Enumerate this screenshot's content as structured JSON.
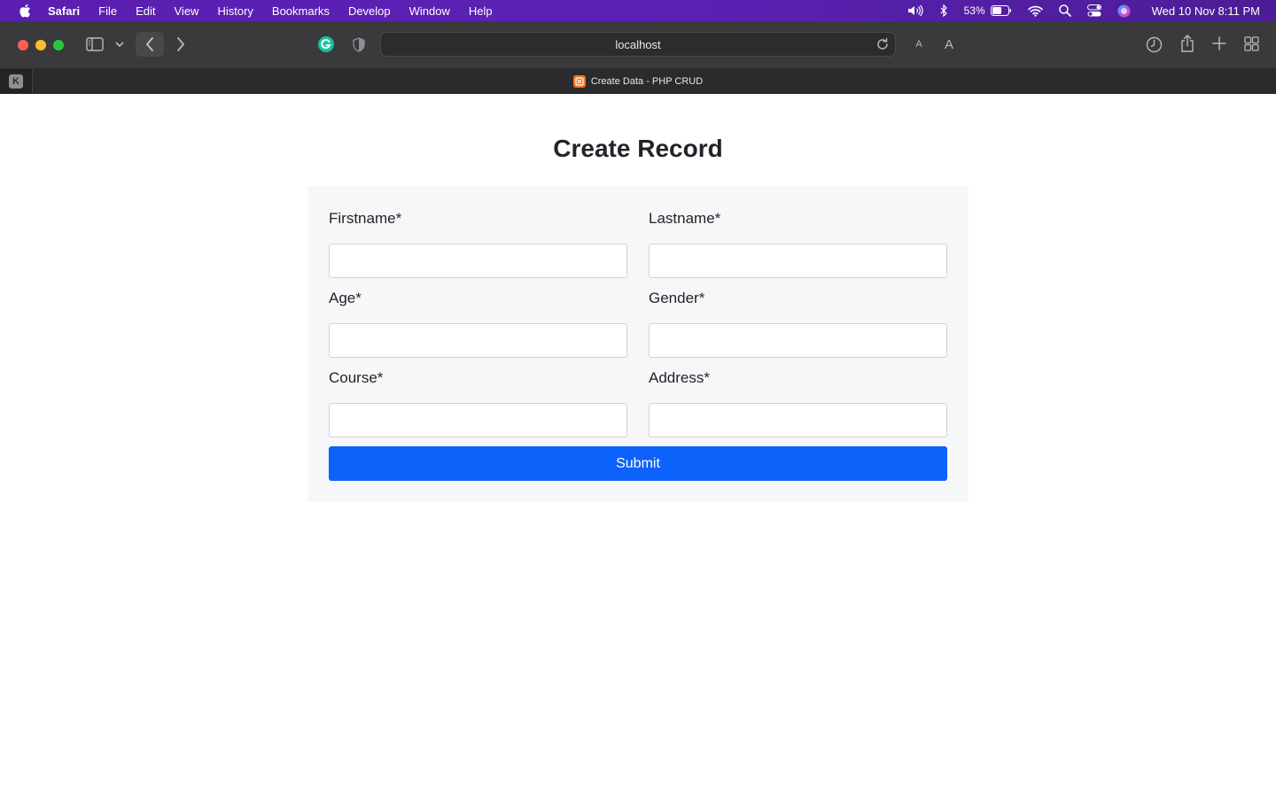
{
  "menubar": {
    "app_name": "Safari",
    "items": [
      "File",
      "Edit",
      "View",
      "History",
      "Bookmarks",
      "Develop",
      "Window",
      "Help"
    ],
    "battery_percent": "53%",
    "clock": "Wed 10 Nov  8:11 PM"
  },
  "toolbar": {
    "url": "localhost",
    "font_small": "A",
    "font_large": "A"
  },
  "tabbar": {
    "pinned_letter": "K",
    "tab_title": "Create Data - PHP CRUD"
  },
  "page": {
    "title": "Create Record",
    "fields": {
      "firstname": {
        "label": "Firstname*",
        "value": ""
      },
      "lastname": {
        "label": "Lastname*",
        "value": ""
      },
      "age": {
        "label": "Age*",
        "value": ""
      },
      "gender": {
        "label": "Gender*",
        "value": ""
      },
      "course": {
        "label": "Course*",
        "value": ""
      },
      "address": {
        "label": "Address*",
        "value": ""
      }
    },
    "submit_label": "Submit"
  },
  "colors": {
    "menubar": "#5b21b6",
    "toolbar": "#3a3a3c",
    "submit": "#0d62fb",
    "form_bg": "#f6f7f8"
  }
}
